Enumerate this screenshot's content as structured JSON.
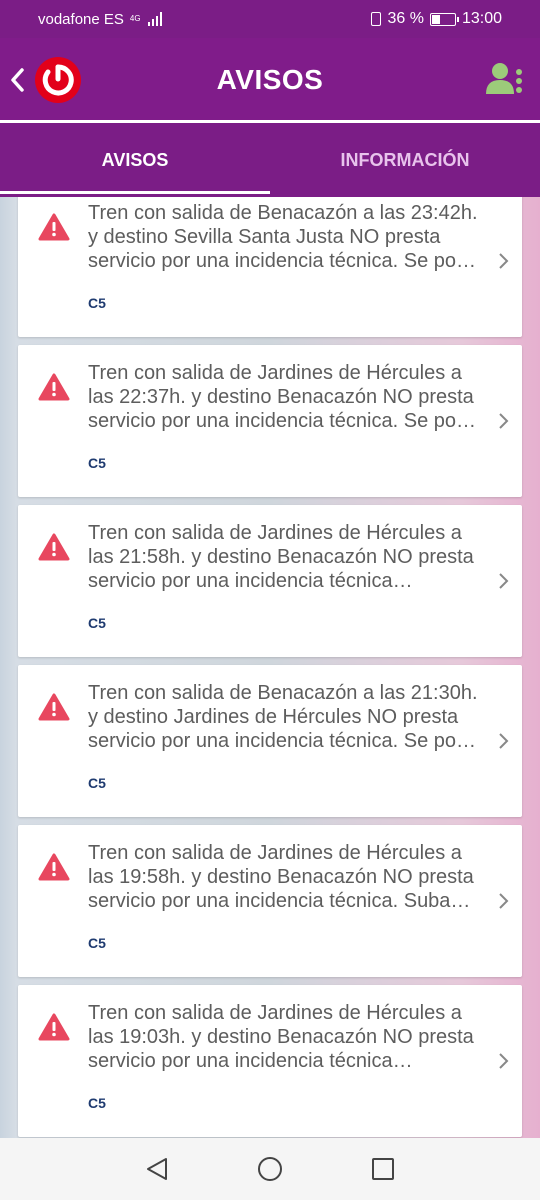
{
  "status_bar": {
    "carrier": "vodafone ES",
    "network": "4G",
    "battery": "36 %",
    "battery_level": 0.36,
    "time": "13:00"
  },
  "app_bar": {
    "title": "AVISOS",
    "back_icon": "chevron-left-icon",
    "logo_icon": "renfe-cercanias-logo",
    "user_icon": "user-menu-icon"
  },
  "tabs": [
    {
      "label": "AVISOS",
      "active": true
    },
    {
      "label": "INFORMACIÓN",
      "active": false
    }
  ],
  "notices": [
    {
      "text": "Tren con salida de Benacazón a las 23:42h. y destino Sevilla Santa Justa NO presta servicio por una incidencia técnica. Se po…",
      "line": "C5"
    },
    {
      "text": "Tren con salida de Jardines de Hércules a las 22:37h. y destino Benacazón NO presta servicio por una incidencia técnica. Se po…",
      "line": "C5"
    },
    {
      "text": "Tren con salida de Jardines de Hércules a las 21:58h. y destino Benacazón NO presta servicio por una incidencia técnica…",
      "line": "C5"
    },
    {
      "text": "Tren con salida de Benacazón a las 21:30h. y destino Jardines de Hércules NO presta servicio por una incidencia técnica. Se po…",
      "line": "C5"
    },
    {
      "text": "Tren con salida de Jardines de Hércules a las 19:58h. y destino Benacazón NO presta servicio por una incidencia técnica. Suba…",
      "line": "C5"
    },
    {
      "text": "Tren con salida de Jardines de Hércules a las 19:03h. y destino Benacazón NO presta servicio por una incidencia técnica…",
      "line": "C5"
    }
  ],
  "colors": {
    "brand_purple": "#7b1d86",
    "warning_red": "#e8475f",
    "line_badge": "#1f3b70",
    "user_icon_green": "#9ccb7a"
  }
}
